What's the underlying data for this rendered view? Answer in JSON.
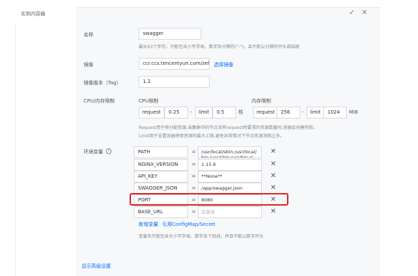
{
  "section": {
    "title": "实例内容器"
  },
  "icons": {
    "confirm": "check-icon",
    "close": "close-icon",
    "info": "info-icon",
    "delete": "delete-x-icon"
  },
  "colors": {
    "link": "#006eff",
    "highlight": "#e02020"
  },
  "form": {
    "name": {
      "label": "名称",
      "value": "swagger",
      "hint": "最长63个字符，只能包含小写字母、数字及分隔符(\"-\")，且不能以分隔符开头或结尾"
    },
    "image": {
      "label": "镜像",
      "value": "ccr.ccs.tencentyun.com/zehu",
      "link": "选择镜像"
    },
    "tag": {
      "label": "镜像版本（Tag）",
      "value": "1.2"
    },
    "limits": {
      "label": "CPU/内存限制",
      "cpu_header": "CPU限制",
      "mem_header": "内存限制",
      "request_label": "request",
      "limit_label": "limit",
      "cpu_request": "0.25",
      "cpu_limit": "0.5",
      "cpu_unit": "核",
      "mem_request": "256",
      "mem_limit": "1024",
      "mem_unit": "MiB",
      "dash": "-",
      "hint1": "Request用于预分配资源,当集群中的节点没有request所要求的资源数量时,容器会创建失败。",
      "hint2": "Limit用于设置容器使用资源的最大上限,避免异常情况下节点资源消耗过多。"
    },
    "env": {
      "label": "环境变量",
      "eq": "=",
      "x": "✕",
      "rows": [
        {
          "key": "PATH",
          "value": "/usr/local/sbin:/usr/local/bin:/usr/sbin:/usr/bin:/s"
        },
        {
          "key": "NGINX_VERSION",
          "value": "1.15.9"
        },
        {
          "key": "API_KEY",
          "value": "**None**"
        },
        {
          "key": "SWAGGER_JSON",
          "value": "/app/swagger.json"
        },
        {
          "key": "PORT",
          "value": "8080"
        },
        {
          "key": "BASE_URL",
          "value": "",
          "placeholder": "变量值"
        }
      ],
      "add_link": "新增变量",
      "ref_link": "引用ConfigMap/Secret",
      "hint": "变量名只能包含大小写字母、数字及下划线，并且不能以数字开头"
    },
    "advanced_link": "显示高级设置"
  }
}
